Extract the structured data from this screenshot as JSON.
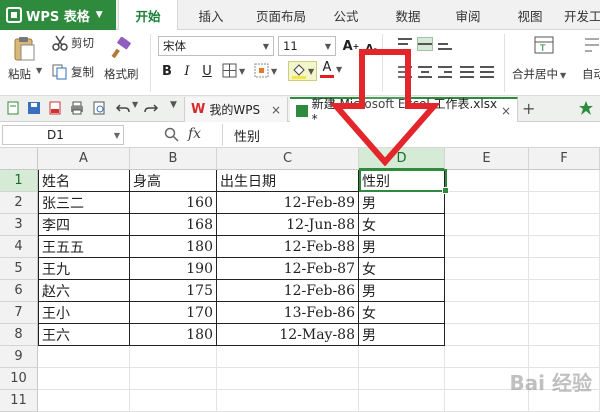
{
  "app": {
    "name": "WPS 表格"
  },
  "menu": {
    "tabs": [
      "开始",
      "插入",
      "页面布局",
      "公式",
      "数据",
      "审阅",
      "视图",
      "开发工"
    ]
  },
  "ribbon": {
    "paste": "粘贴",
    "cut": "剪切",
    "copy": "复制",
    "format_painter": "格式刷",
    "font_name": "宋体",
    "font_size": "11",
    "bold": "B",
    "italic": "I",
    "underline": "U",
    "font_color_glyph": "A",
    "grow_font": "A",
    "shrink_font": "A",
    "merge_center": "合并居中",
    "auto_wrap": "自动",
    "colors": {
      "fill": "#f5e642",
      "font": "#e02020",
      "brand": "#2e8b3e"
    }
  },
  "doc_tabs": [
    {
      "label": "我的WPS",
      "close": "×"
    },
    {
      "label": "新建 Microsoft Excel 工作表.xlsx *",
      "close": "×"
    }
  ],
  "new_tab": "+",
  "formula_bar": {
    "name_box": "D1",
    "fx": "fx",
    "content": "性别"
  },
  "grid": {
    "columns": [
      "A",
      "B",
      "C",
      "D",
      "E",
      "F"
    ],
    "rows": [
      "1",
      "2",
      "3",
      "4",
      "5",
      "6",
      "7",
      "8",
      "9",
      "10",
      "11"
    ],
    "active_cell": "D1",
    "data": [
      [
        "姓名",
        "身高",
        "出生日期",
        "性别"
      ],
      [
        "张三二",
        "160",
        "12-Feb-89",
        "男"
      ],
      [
        "李四",
        "168",
        "12-Jun-88",
        "女"
      ],
      [
        "王五五",
        "180",
        "12-Feb-88",
        "男"
      ],
      [
        "王九",
        "190",
        "12-Feb-87",
        "女"
      ],
      [
        "赵六",
        "175",
        "12-Feb-86",
        "男"
      ],
      [
        "王小",
        "170",
        "13-Feb-86",
        "女"
      ],
      [
        "王六",
        "180",
        "12-May-88",
        "男"
      ]
    ]
  },
  "watermark": "Bai 经验"
}
